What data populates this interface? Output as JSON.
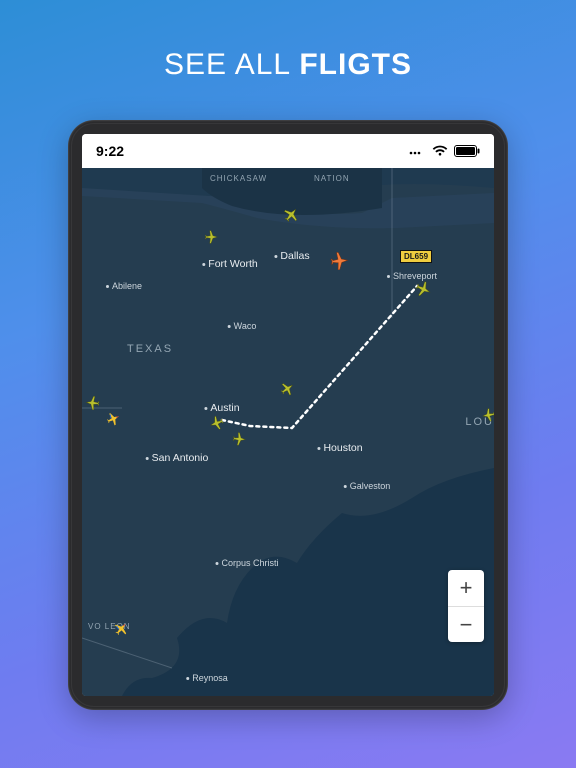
{
  "promo": {
    "headline_light": "SEE ALL ",
    "headline_bold": "FLIGTS"
  },
  "statusbar": {
    "time": "9:22"
  },
  "regions": {
    "texas": "TEXAS",
    "chickasaw": "CHICKASAW",
    "nation": "NATION",
    "louisiana_cut": "LOU",
    "vo_leon": "VO LEON"
  },
  "cities": {
    "fort_worth": "Fort Worth",
    "dallas": "Dallas",
    "shreveport": "Shreveport",
    "abilene": "Abilene",
    "waco": "Waco",
    "austin": "Austin",
    "san_antonio": "San Antonio",
    "houston": "Houston",
    "galveston": "Galveston",
    "corpus_christi": "Corpus Christi",
    "reynosa": "Reynosa"
  },
  "flight": {
    "selected_callsign": "DL659"
  },
  "zoom": {
    "in": "+",
    "out": "−"
  }
}
